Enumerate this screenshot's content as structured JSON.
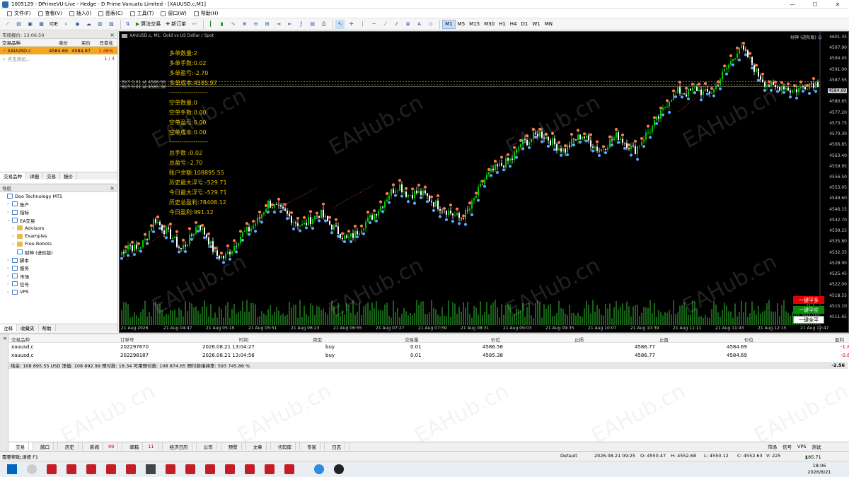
{
  "window": {
    "title": "1005129 - DPrimeVU-Live - Hedge - D Prime Vanuatu Limited - [XAUUSD.c,M1]",
    "controls": [
      "—",
      "☐",
      "✕"
    ]
  },
  "menu": [
    "文件(F)",
    "查看(V)",
    "插入(I)",
    "图表(C)",
    "工具(T)",
    "窗口(W)",
    "帮助(H)"
  ],
  "toolbar": {
    "ide": "IDE",
    "algo": "算法交易",
    "new_order": "新订单",
    "timeframes": [
      "M1",
      "M5",
      "M15",
      "M30",
      "H1",
      "H4",
      "D1",
      "W1",
      "MN"
    ],
    "active_timeframe": "M1"
  },
  "market_watch": {
    "header": "市场报价: 13:06:50",
    "columns": [
      "交易品种",
      "卖价",
      "买价",
      "日变化"
    ],
    "rows": [
      {
        "symbol": "XAUUSD.c",
        "bid": "4584.69",
        "ask": "4584.87",
        "change": "1.46%"
      }
    ],
    "add_row": "点击添加...",
    "count": "1 / 4",
    "tabs": [
      "交易品种",
      "详细",
      "交易",
      "报价"
    ]
  },
  "navigator": {
    "header": "导航",
    "items": [
      {
        "label": "Doo Technology MT5",
        "level": 0,
        "arrow": "",
        "icon": "app-icon"
      },
      {
        "label": "账户",
        "level": 1,
        "arrow": "›",
        "icon": "account-icon"
      },
      {
        "label": "指标",
        "level": 1,
        "arrow": "›",
        "icon": "indicator-icon"
      },
      {
        "label": "EA交易",
        "level": 1,
        "arrow": "⌄",
        "icon": "ea-icon"
      },
      {
        "label": "Advisors",
        "level": 2,
        "arrow": "›",
        "icon": "folder-icon"
      },
      {
        "label": "Examples",
        "level": 2,
        "arrow": "›",
        "icon": "folder-icon"
      },
      {
        "label": "Free Robots",
        "level": 2,
        "arrow": "›",
        "icon": "folder-icon"
      },
      {
        "label": "财神 (进阶版)",
        "level": 2,
        "arrow": "",
        "icon": "ea-icon"
      },
      {
        "label": "脚本",
        "level": 1,
        "arrow": "›",
        "icon": "script-icon"
      },
      {
        "label": "服务",
        "level": 1,
        "arrow": "›",
        "icon": "service-icon"
      },
      {
        "label": "市场",
        "level": 1,
        "arrow": "›",
        "icon": "market-icon"
      },
      {
        "label": "信号",
        "level": 1,
        "arrow": "›",
        "icon": "signal-icon"
      },
      {
        "label": "VPS",
        "level": 1,
        "arrow": "›",
        "icon": "vps-icon"
      }
    ],
    "tabs": [
      "注释",
      "收藏夹",
      "帮助"
    ]
  },
  "chart": {
    "symbol_line": "XAUUSD.c, M1: Gold vs US Dollar / Spot",
    "top_right": "财神 (进阶版)",
    "buy_labels": [
      "BUY 0.01 at 4586.56",
      "BUY 0.01 at 4585.38"
    ],
    "info_lines": [
      "多单数量:2",
      "多单手数:0.02",
      "多单盈亏:-2.70",
      "多单成本:4585.97",
      "-------------------",
      "空单数量:0",
      "空单手数:0.00",
      "空单盈亏:0.00",
      "空单成本:0.00",
      "-------------------",
      "总手数 :0.02",
      "总盈亏:-2.70",
      "账户余额:108895.55",
      "历史最大浮亏:-529.71",
      "今日最大浮亏:-529.71",
      "历史总盈利:78408.12",
      "今日盈利:991.12"
    ],
    "price_axis": [
      "4601.35",
      "4597.90",
      "4594.45",
      "4591.00",
      "4587.55",
      "4584.69",
      "4580.65",
      "4577.20",
      "4573.75",
      "4570.30",
      "4566.85",
      "4563.40",
      "4559.95",
      "4556.50",
      "4553.05",
      "4549.60",
      "4546.15",
      "4542.70",
      "4539.25",
      "4535.80",
      "4532.35",
      "4528.90",
      "4525.45",
      "4522.00",
      "4518.55",
      "4515.10",
      "4511.65"
    ],
    "time_axis": [
      "21 Aug 2026",
      "21 Aug 04:47",
      "21 Aug 05:19",
      "21 Aug 05:51",
      "21 Aug 06:23",
      "21 Aug 06:55",
      "21 Aug 07:27",
      "21 Aug 07:59",
      "21 Aug 08:31",
      "21 Aug 09:03",
      "21 Aug 09:35",
      "21 Aug 10:07",
      "21 Aug 10:39",
      "21 Aug 11:11",
      "21 Aug 11:43",
      "21 Aug 12:15",
      "21 Aug 12:47"
    ],
    "buttons": [
      {
        "label": "一键平多",
        "bg": "#e00000",
        "fg": "#ffffff"
      },
      {
        "label": "一键平空",
        "bg": "#0a8a0a",
        "fg": "#ffffff"
      },
      {
        "label": "一键全平",
        "bg": "#ffffff",
        "fg": "#000000"
      }
    ],
    "close_series": [
      4520,
      4524,
      4522,
      4526,
      4534,
      4530,
      4527,
      4522,
      4526,
      4532,
      4527,
      4520,
      4519,
      4523,
      4528,
      4530,
      4534,
      4540,
      4538,
      4536,
      4533,
      4531,
      4534,
      4536,
      4532,
      4529,
      4526,
      4528,
      4532,
      4535,
      4539,
      4544,
      4547,
      4543,
      4544,
      4543,
      4540,
      4538,
      4536,
      4534,
      4537,
      4544,
      4550,
      4553,
      4555,
      4557,
      4563,
      4564,
      4567,
      4565,
      4562,
      4560,
      4564,
      4566,
      4563,
      4560,
      4563,
      4566,
      4563,
      4560,
      4565,
      4569,
      4574,
      4580,
      4583,
      4582,
      4584,
      4582,
      4583,
      4589,
      4594,
      4600,
      4596,
      4590,
      4586,
      4584,
      4585,
      4583,
      4584,
      4586,
      4586
    ],
    "colors": {
      "bull": "#00c800",
      "bear": "#ffffff",
      "info": "#e6c200",
      "bg": "#000000"
    }
  },
  "positions": {
    "columns": [
      "交易品种",
      "订单号",
      "时间",
      "类型",
      "交易量",
      "价位",
      "止损",
      "止盈",
      "价位",
      "盈利"
    ],
    "rows": [
      {
        "symbol": "xauusd.c",
        "ticket": "202297670",
        "time": "2026.08.21 13:04:27",
        "type": "buy",
        "volume": "0.01",
        "open": "4586.56",
        "sl": "",
        "tp": "4586.77",
        "price": "4584.69",
        "profit": "-1.87"
      },
      {
        "symbol": "xauusd.c",
        "ticket": "202298187",
        "time": "2026.08.21 13:04:56",
        "type": "buy",
        "volume": "0.01",
        "open": "4585.38",
        "sl": "",
        "tp": "4586.77",
        "price": "4584.69",
        "profit": "-0.69"
      }
    ],
    "balance_line": "结余: 108 895.55 USD  净值: 108 892.99  预付款: 18.34  可用预付款: 108 874.65  预付款维持率: 593 745.86 %",
    "total": "-2.56"
  },
  "terminal_tabs": [
    {
      "label": "交易",
      "badge": ""
    },
    {
      "label": "敞口",
      "badge": ""
    },
    {
      "label": "历史",
      "badge": ""
    },
    {
      "label": "新闻",
      "badge": "99"
    },
    {
      "label": "邮箱",
      "badge": "11"
    },
    {
      "label": "经济日历",
      "badge": ""
    },
    {
      "label": "公司",
      "badge": ""
    },
    {
      "label": "预警",
      "badge": ""
    },
    {
      "label": "文章",
      "badge": ""
    },
    {
      "label": "代码库",
      "badge": ""
    },
    {
      "label": "专家",
      "badge": ""
    },
    {
      "label": "日志",
      "badge": ""
    }
  ],
  "terminal_right": [
    "市场",
    "信号",
    "VPS",
    "测试"
  ],
  "status": {
    "left": "需要帮助,请按 F1",
    "profile": "Default",
    "datetime": "2026.08.21 09:25",
    "o": "O: 4550.47",
    "h": "H: 4552.68",
    "l": "L: 4550.12",
    "c": "C: 4552.63",
    "v": "V: 225",
    "ping": "185.71 ms"
  },
  "taskbar": {
    "time": "18:06",
    "date": "2026/8/21"
  },
  "watermark": "EAHub.cn"
}
